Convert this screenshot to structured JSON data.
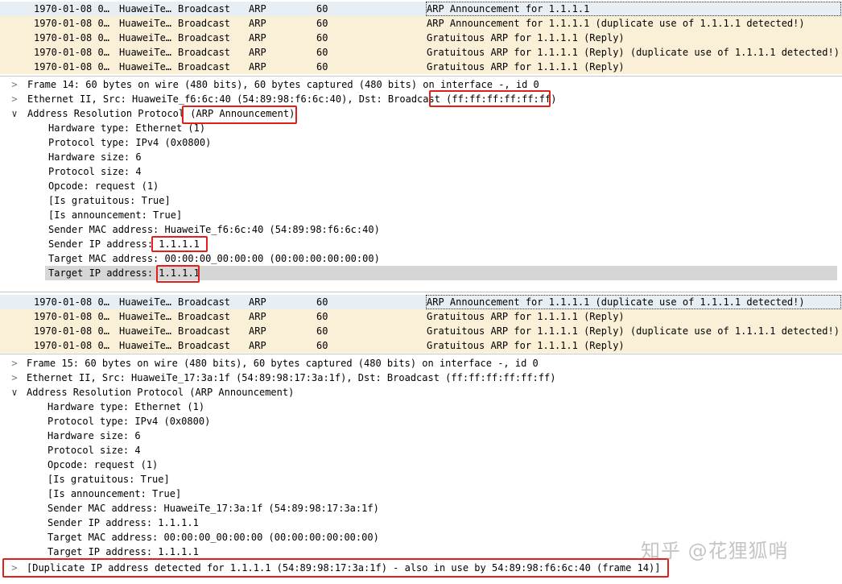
{
  "packet_list_1": [
    {
      "time": "1970-01-08 0…",
      "source": "HuaweiTe…",
      "destination": "Broadcast",
      "protocol": "ARP",
      "length": "60",
      "info": "ARP Announcement for 1.1.1.1",
      "selected": true
    },
    {
      "time": "1970-01-08 0…",
      "source": "HuaweiTe…",
      "destination": "Broadcast",
      "protocol": "ARP",
      "length": "60",
      "info": "ARP Announcement for 1.1.1.1 (duplicate use of 1.1.1.1 detected!)",
      "selected": false
    },
    {
      "time": "1970-01-08 0…",
      "source": "HuaweiTe…",
      "destination": "Broadcast",
      "protocol": "ARP",
      "length": "60",
      "info": "Gratuitous ARP for 1.1.1.1 (Reply)",
      "selected": false
    },
    {
      "time": "1970-01-08 0…",
      "source": "HuaweiTe…",
      "destination": "Broadcast",
      "protocol": "ARP",
      "length": "60",
      "info": "Gratuitous ARP for 1.1.1.1 (Reply) (duplicate use of 1.1.1.1 detected!)",
      "selected": false
    },
    {
      "time": "1970-01-08 0…",
      "source": "HuaweiTe…",
      "destination": "Broadcast",
      "protocol": "ARP",
      "length": "60",
      "info": "Gratuitous ARP for 1.1.1.1 (Reply)",
      "selected": false
    }
  ],
  "details_1": {
    "frame": "Frame 14: 60 bytes on wire (480 bits), 60 bytes captured (480 bits) on interface -, id 0",
    "ethernet": "Ethernet II, Src: HuaweiTe_f6:6c:40 (54:89:98:f6:6c:40), Dst: Broadcast (ff:ff:ff:ff:ff:ff)",
    "arp": "Address Resolution Protocol (ARP Announcement)",
    "fields": [
      "Hardware type: Ethernet (1)",
      "Protocol type: IPv4 (0x0800)",
      "Hardware size: 6",
      "Protocol size: 4",
      "Opcode: request (1)",
      "[Is gratuitous: True]",
      "[Is announcement: True]",
      "Sender MAC address: HuaweiTe_f6:6c:40 (54:89:98:f6:6c:40)",
      "Sender IP address: 1.1.1.1",
      "Target MAC address: 00:00:00_00:00:00 (00:00:00:00:00:00)",
      "Target IP address: 1.1.1.1"
    ]
  },
  "packet_list_2": [
    {
      "time": "1970-01-08 0…",
      "source": "HuaweiTe…",
      "destination": "Broadcast",
      "protocol": "ARP",
      "length": "60",
      "info": "ARP Announcement for 1.1.1.1 (duplicate use of 1.1.1.1 detected!)",
      "selected": true
    },
    {
      "time": "1970-01-08 0…",
      "source": "HuaweiTe…",
      "destination": "Broadcast",
      "protocol": "ARP",
      "length": "60",
      "info": "Gratuitous ARP for 1.1.1.1 (Reply)",
      "selected": false
    },
    {
      "time": "1970-01-08 0…",
      "source": "HuaweiTe…",
      "destination": "Broadcast",
      "protocol": "ARP",
      "length": "60",
      "info": "Gratuitous ARP for 1.1.1.1 (Reply) (duplicate use of 1.1.1.1 detected!)",
      "selected": false
    },
    {
      "time": "1970-01-08 0…",
      "source": "HuaweiTe…",
      "destination": "Broadcast",
      "protocol": "ARP",
      "length": "60",
      "info": "Gratuitous ARP for 1.1.1.1 (Reply)",
      "selected": false
    }
  ],
  "details_2": {
    "frame": "Frame 15: 60 bytes on wire (480 bits), 60 bytes captured (480 bits) on interface -, id 0",
    "ethernet": "Ethernet II, Src: HuaweiTe_17:3a:1f (54:89:98:17:3a:1f), Dst: Broadcast (ff:ff:ff:ff:ff:ff)",
    "arp": "Address Resolution Protocol (ARP Announcement)",
    "fields": [
      "Hardware type: Ethernet (1)",
      "Protocol type: IPv4 (0x0800)",
      "Hardware size: 6",
      "Protocol size: 4",
      "Opcode: request (1)",
      "[Is gratuitous: True]",
      "[Is announcement: True]",
      "Sender MAC address: HuaweiTe_17:3a:1f (54:89:98:17:3a:1f)",
      "Sender IP address: 1.1.1.1",
      "Target MAC address: 00:00:00_00:00:00 (00:00:00:00:00:00)",
      "Target IP address: 1.1.1.1"
    ],
    "expert": "[Duplicate IP address detected for 1.1.1.1 (54:89:98:17:3a:1f) - also in use by 54:89:98:f6:6c:40 (frame 14)]"
  },
  "icons": {
    "collapsed": "chevron-right-icon",
    "expanded": "chevron-down-icon"
  },
  "watermark": "知乎 @花狸狐哨",
  "colors": {
    "row_bg": "#faf0d7",
    "selected_row_bg": "#e7eff5",
    "highlight_field": "#d6d6d6",
    "expert_warning": "#fbf58a",
    "annotation_box": "#e0201b"
  }
}
